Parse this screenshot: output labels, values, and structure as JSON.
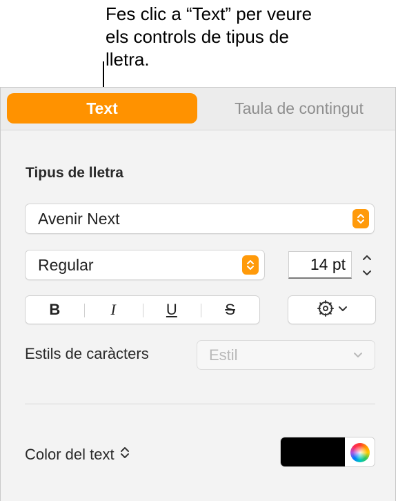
{
  "callout": {
    "text": "Fes clic a “Text” per veure els controls de tipus de lletra."
  },
  "tabs": [
    {
      "label": "Text",
      "active": true
    },
    {
      "label": "Taula de contingut",
      "active": false
    }
  ],
  "font_section": {
    "title": "Tipus de lletra",
    "font_family": "Avenir Next",
    "font_style": "Regular",
    "font_size": "14 pt"
  },
  "format_buttons": {
    "bold": "B",
    "italic": "I",
    "underline": "U",
    "strikethrough": "S"
  },
  "character_styles": {
    "label": "Estils de caràcters",
    "placeholder": "Estil"
  },
  "text_color": {
    "label": "Color del text",
    "swatch": "#000000"
  },
  "colors": {
    "accent": "#ff9200",
    "stepper": "#ff9a0a"
  },
  "icons": [
    "chevron-updown-icon",
    "gear-icon",
    "chevron-down-icon",
    "color-wheel-icon"
  ]
}
